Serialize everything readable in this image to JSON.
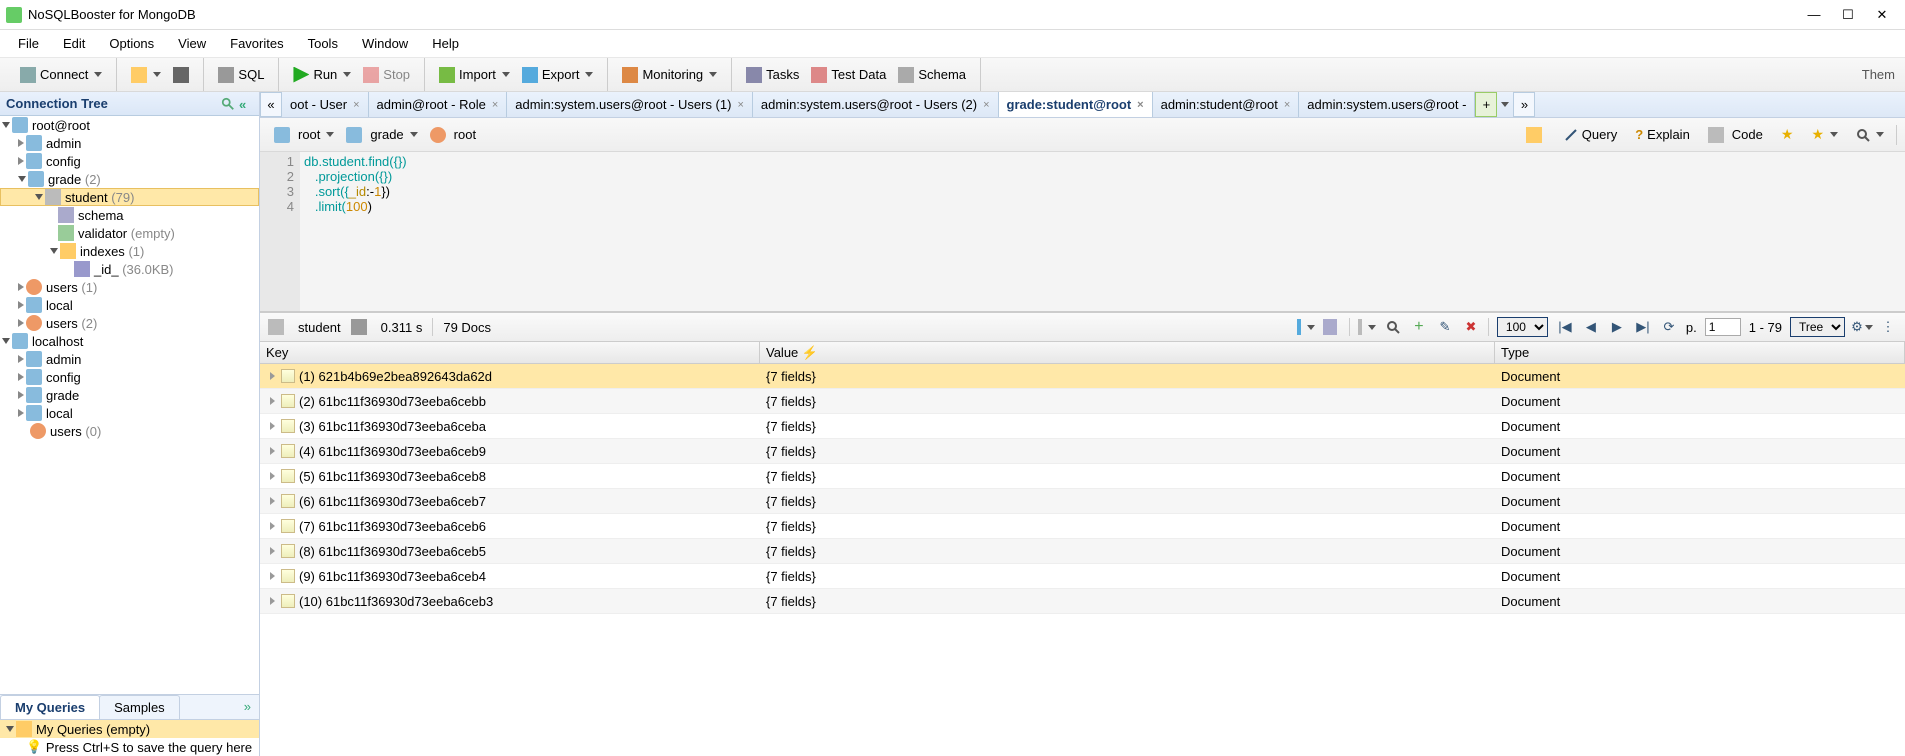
{
  "title": "NoSQLBooster for MongoDB",
  "menu": [
    "File",
    "Edit",
    "Options",
    "View",
    "Favorites",
    "Tools",
    "Window",
    "Help"
  ],
  "toolbar": {
    "connect": "Connect",
    "run": "Run",
    "stop": "Stop",
    "import": "Import",
    "export": "Export",
    "monitoring": "Monitoring",
    "tasks": "Tasks",
    "test_data": "Test Data",
    "schema": "Schema",
    "theme": "Them",
    "sql": "SQL"
  },
  "sidebar": {
    "header": "Connection Tree",
    "tree": {
      "root_conn": "root@root",
      "admin": "admin",
      "config": "config",
      "grade": "grade",
      "grade_cnt": "(2)",
      "student": "student",
      "student_cnt": "(79)",
      "schema": "schema",
      "validator": "validator",
      "validator_empty": "(empty)",
      "indexes": "indexes",
      "indexes_cnt": "(1)",
      "id_index": "_id_",
      "id_index_size": "(36.0KB)",
      "users1": "users",
      "users1_cnt": "(1)",
      "local": "local",
      "users2": "users",
      "users2_cnt": "(2)",
      "localhost": "localhost",
      "lh_admin": "admin",
      "lh_config": "config",
      "lh_grade": "grade",
      "lh_local": "local",
      "lh_users": "users",
      "lh_users_cnt": "(0)"
    },
    "bottom_tabs": {
      "my_queries": "My Queries",
      "samples": "Samples"
    },
    "mq_title": "My Queries (empty)",
    "mq_hint": "Press Ctrl+S to save the query here"
  },
  "tabs": [
    {
      "label": "oot - User",
      "active": false
    },
    {
      "label": "admin@root - Role",
      "active": false
    },
    {
      "label": "admin:system.users@root - Users (1)",
      "active": false
    },
    {
      "label": "admin:system.users@root - Users (2)",
      "active": false
    },
    {
      "label": "grade:student@root",
      "active": true
    },
    {
      "label": "admin:student@root",
      "active": false
    },
    {
      "label": "admin:system.users@root -",
      "active": false
    }
  ],
  "sub_toolbar": {
    "conn": "root",
    "db": "grade",
    "user": "root",
    "query": "Query",
    "explain": "Explain",
    "code": "Code"
  },
  "editor": {
    "lines": [
      "1",
      "2",
      "3",
      "4"
    ],
    "code": {
      "l1": "db.student.find({})",
      "l2": "   .projection({})",
      "l3a": "   .sort({",
      "l3b": "_id",
      "l3c": ":-",
      "l3d": "1",
      "l3e": "})",
      "l4a": "   .limit(",
      "l4b": "100",
      "l4c": ")"
    }
  },
  "results": {
    "coll": "student",
    "time": "0.311 s",
    "docs": "79 Docs",
    "limit": "100",
    "page": "1",
    "range": "1 - 79",
    "mode": "Tree",
    "p_label": "p."
  },
  "grid_hdr": {
    "key": "Key",
    "value": "Value",
    "type": "Type"
  },
  "grid_rows": [
    {
      "key": "(1) 621b4b69e2bea892643da62d",
      "val": "{7 fields}",
      "type": "Document",
      "sel": true
    },
    {
      "key": "(2) 61bc11f36930d73eeba6cebb",
      "val": "{7 fields}",
      "type": "Document"
    },
    {
      "key": "(3) 61bc11f36930d73eeba6ceba",
      "val": "{7 fields}",
      "type": "Document"
    },
    {
      "key": "(4) 61bc11f36930d73eeba6ceb9",
      "val": "{7 fields}",
      "type": "Document"
    },
    {
      "key": "(5) 61bc11f36930d73eeba6ceb8",
      "val": "{7 fields}",
      "type": "Document"
    },
    {
      "key": "(6) 61bc11f36930d73eeba6ceb7",
      "val": "{7 fields}",
      "type": "Document"
    },
    {
      "key": "(7) 61bc11f36930d73eeba6ceb6",
      "val": "{7 fields}",
      "type": "Document"
    },
    {
      "key": "(8) 61bc11f36930d73eeba6ceb5",
      "val": "{7 fields}",
      "type": "Document"
    },
    {
      "key": "(9) 61bc11f36930d73eeba6ceb4",
      "val": "{7 fields}",
      "type": "Document"
    },
    {
      "key": "(10) 61bc11f36930d73eeba6ceb3",
      "val": "{7 fields}",
      "type": "Document"
    }
  ]
}
